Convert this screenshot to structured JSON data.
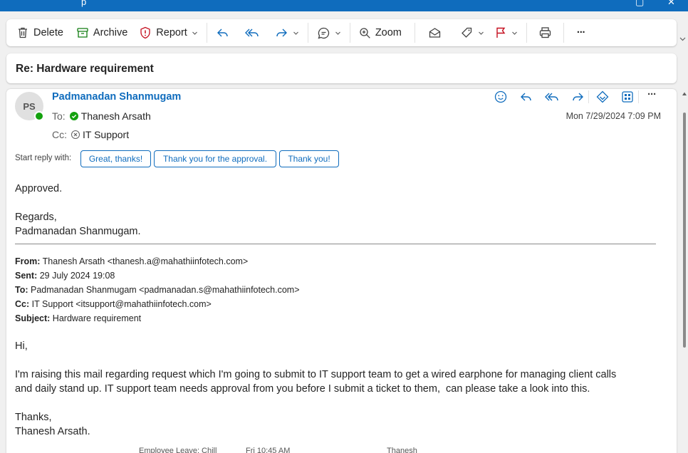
{
  "title_bar": {
    "glyph_left": "p",
    "glyph_min": "▢",
    "glyph_close": "✕"
  },
  "toolbar": {
    "delete_label": "Delete",
    "archive_label": "Archive",
    "report_label": "Report",
    "zoom_label": "Zoom",
    "more_label": "···"
  },
  "message": {
    "subject": "Re: Hardware requirement",
    "sender_initials": "PS",
    "sender_name": "Padmanadan Shanmugam",
    "to_label": "To:",
    "to_name": "Thanesh Arsath",
    "cc_label": "Cc:",
    "cc_name": "IT Support",
    "date": "Mon 7/29/2024 7:09 PM",
    "more_label": "···"
  },
  "quick_reply": {
    "label": "Start reply with:",
    "options": [
      "Great, thanks!",
      "Thank you for the approval.",
      "Thank you!"
    ]
  },
  "body": {
    "line1": "Approved.",
    "line2": "Regards,",
    "line3": "Padmanadan Shanmugam."
  },
  "quoted": {
    "from_label": "From:",
    "from_value": "Thanesh Arsath <thanesh.a@mahathiinfotech.com>",
    "sent_label": "Sent:",
    "sent_value": "29 July 2024 19:08",
    "to_label": "To:",
    "to_value": "Padmanadan Shanmugam <padmanadan.s@mahathiinfotech.com>",
    "cc_label": "Cc:",
    "cc_value": "IT Support <itsupport@mahathiinfotech.com>",
    "subject_label": "Subject:",
    "subject_value": "Hardware requirement",
    "greeting": "Hi,",
    "para1": "I'm raising this mail regarding request which I'm going to submit to IT support team to get a wired earphone for managing client calls",
    "para2": "and daily stand up. IT support team needs approval from you before I submit a ticket to them,  can please take a look into this.",
    "sign1": "Thanks,",
    "sign2": "Thanesh Arsath."
  },
  "peek": {
    "item1": "Employee Leave: Chill",
    "item2": "Fri 10:45 AM",
    "item3": "Thanesh"
  },
  "colors": {
    "accent": "#0f6cbd",
    "danger": "#c50f1f",
    "archive": "#107c10",
    "presence": "#13a10e"
  }
}
